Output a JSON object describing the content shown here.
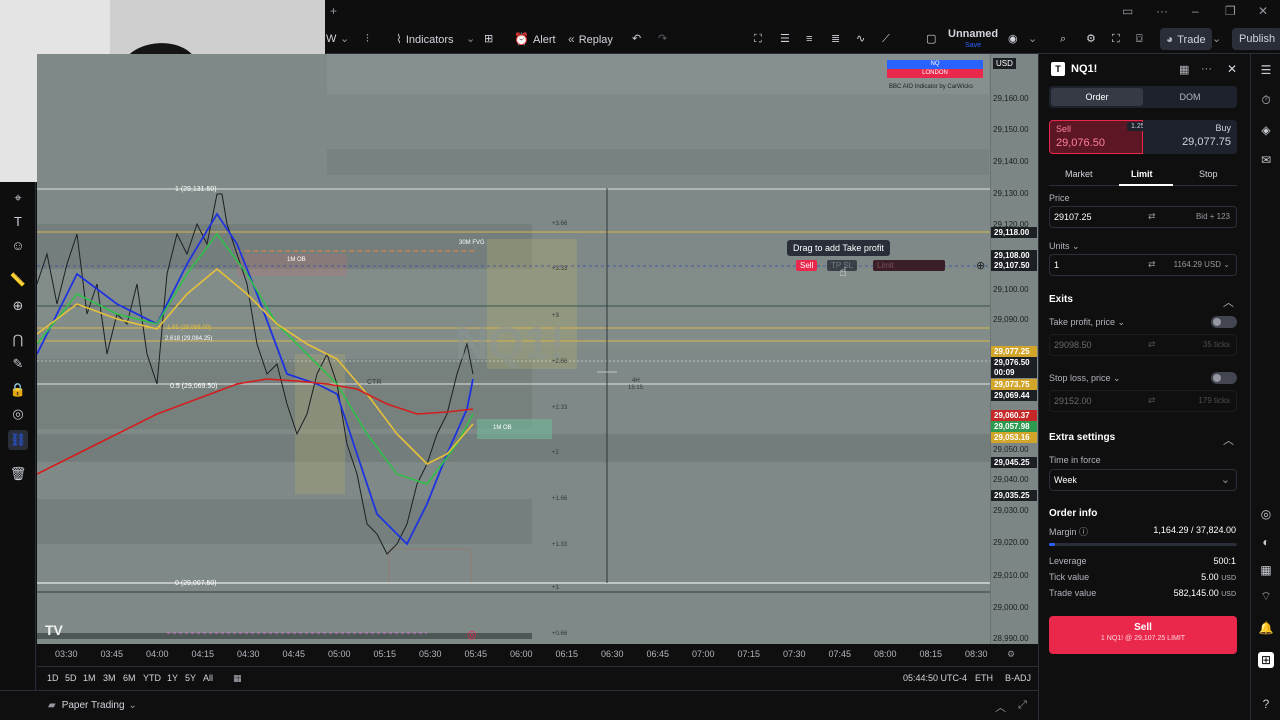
{
  "toolbar": {
    "interval": "W",
    "indicators_label": "Indicators",
    "alert_label": "Alert",
    "replay_label": "Replay",
    "layout_name": "Unnamed",
    "layout_status": "Save",
    "trade_label": "Trade",
    "publish_label": "Publish"
  },
  "chart": {
    "currency": "USD",
    "watermark": "NQ1!",
    "indicator_name": "BBC AIO Indicator by CarWicks",
    "legend_top": "NQ",
    "legend_bottom": "LONDON",
    "tooltip": "Drag to add Take profit",
    "sell_chip": "Sell",
    "tp_chip": "TP",
    "sl_chip": "SL",
    "limit_chip": "Limit",
    "fib_high": "1 (29,131.50)",
    "fib_low": "0 (29,007.50)",
    "fib_mid": "0.5 (29,069.50)",
    "fib_1": "1.65 (29,088.00)",
    "fib_2": "2.618 (29,084.25)",
    "ob_labels": [
      "1M OB",
      "30M FVG",
      "1M OB"
    ],
    "ctr_label": "CTR",
    "side_scale": [
      "+3.66",
      "+3.33",
      "+3",
      "+2.66",
      "+2.33",
      "+2",
      "+1.66",
      "+1.33",
      "+1",
      "+0.66"
    ],
    "crosshair_readout": [
      "4H",
      "15:15"
    ]
  },
  "price_scale": [
    "29,160.00",
    "29,150.00",
    "29,140.00",
    "29,130.00",
    "29,120.00",
    "29,100.00",
    "29,090.00",
    "29,080.00",
    "29,050.00",
    "29,040.00",
    "29,030.00",
    "29,020.00",
    "29,010.00",
    "29,000.00",
    "28,990.00"
  ],
  "price_tags": [
    {
      "text": "29,118.00",
      "bg": "#1c1f24"
    },
    {
      "text": "29,108.00",
      "bg": "#1c1f24"
    },
    {
      "text": "29,107.50",
      "bg": "#1c1f24"
    },
    {
      "text": "29,077.25",
      "bg": "#d1a52a"
    },
    {
      "text": "29,076.50",
      "bg": "#1c1f24"
    },
    {
      "text": "00:09",
      "bg": "#1c1f24"
    },
    {
      "text": "29,073.75",
      "bg": "#d1a52a"
    },
    {
      "text": "29,069.44",
      "bg": "#1c1f24"
    },
    {
      "text": "29,060.37",
      "bg": "#c62828"
    },
    {
      "text": "29,057.98",
      "bg": "#2e9a4f"
    },
    {
      "text": "29,053.16",
      "bg": "#d1a52a"
    },
    {
      "text": "29,045.25",
      "bg": "#1c1f24"
    },
    {
      "text": "29,035.25",
      "bg": "#1c1f24"
    }
  ],
  "time_axis": [
    "03:30",
    "03:45",
    "04:00",
    "04:15",
    "04:30",
    "04:45",
    "05:00",
    "05:15",
    "05:30",
    "05:45",
    "06:00",
    "06:15",
    "06:30",
    "06:45",
    "07:00",
    "07:15",
    "07:30",
    "07:45",
    "08:00",
    "08:15",
    "08:30"
  ],
  "timeframes": [
    "1D",
    "5D",
    "1M",
    "3M",
    "6M",
    "YTD",
    "1Y",
    "5Y",
    "All"
  ],
  "clock": "05:44:50 UTC-4",
  "session": "ETH",
  "adjust": "B-ADJ",
  "footer": {
    "paper_trading": "Paper Trading"
  },
  "order_panel": {
    "symbol": "NQ1!",
    "tabs": [
      "Order",
      "DOM"
    ],
    "sell_label": "Sell",
    "sell_price": "29,076.50",
    "spread": "1.25",
    "buy_label": "Buy",
    "buy_price": "29,077.75",
    "order_types": [
      "Market",
      "Limit",
      "Stop"
    ],
    "price_label": "Price",
    "price_value": "29107.25",
    "price_hint": "Bid + 123",
    "units_label": "Units",
    "units_value": "1",
    "units_hint": "1164.29 USD",
    "exits_label": "Exits",
    "tp_label": "Take profit, price",
    "tp_value": "29098.50",
    "tp_hint": "35 ticks",
    "sl_label": "Stop loss, price",
    "sl_value": "29152.00",
    "sl_hint": "179 ticks",
    "extra_label": "Extra settings",
    "tif_label": "Time in force",
    "tif_value": "Week",
    "info_label": "Order info",
    "margin_label": "Margin",
    "margin_value": "1,164.29 / 37,824.00",
    "margin_fraction": 0.031,
    "leverage_label": "Leverage",
    "leverage_value": "500:1",
    "tick_label": "Tick value",
    "tick_value": "5.00",
    "tick_unit": "USD",
    "trade_value_label": "Trade value",
    "trade_value": "582,145.00",
    "trade_unit": "USD",
    "submit_title": "Sell",
    "submit_sub": "1 NQ1! @ 29,107.25 LIMIT"
  },
  "colors": {
    "sell": "#e9284c",
    "buy": "#2962ff",
    "panel_bg": "#0f0f0f",
    "chart_bg": "#7f8a88"
  }
}
